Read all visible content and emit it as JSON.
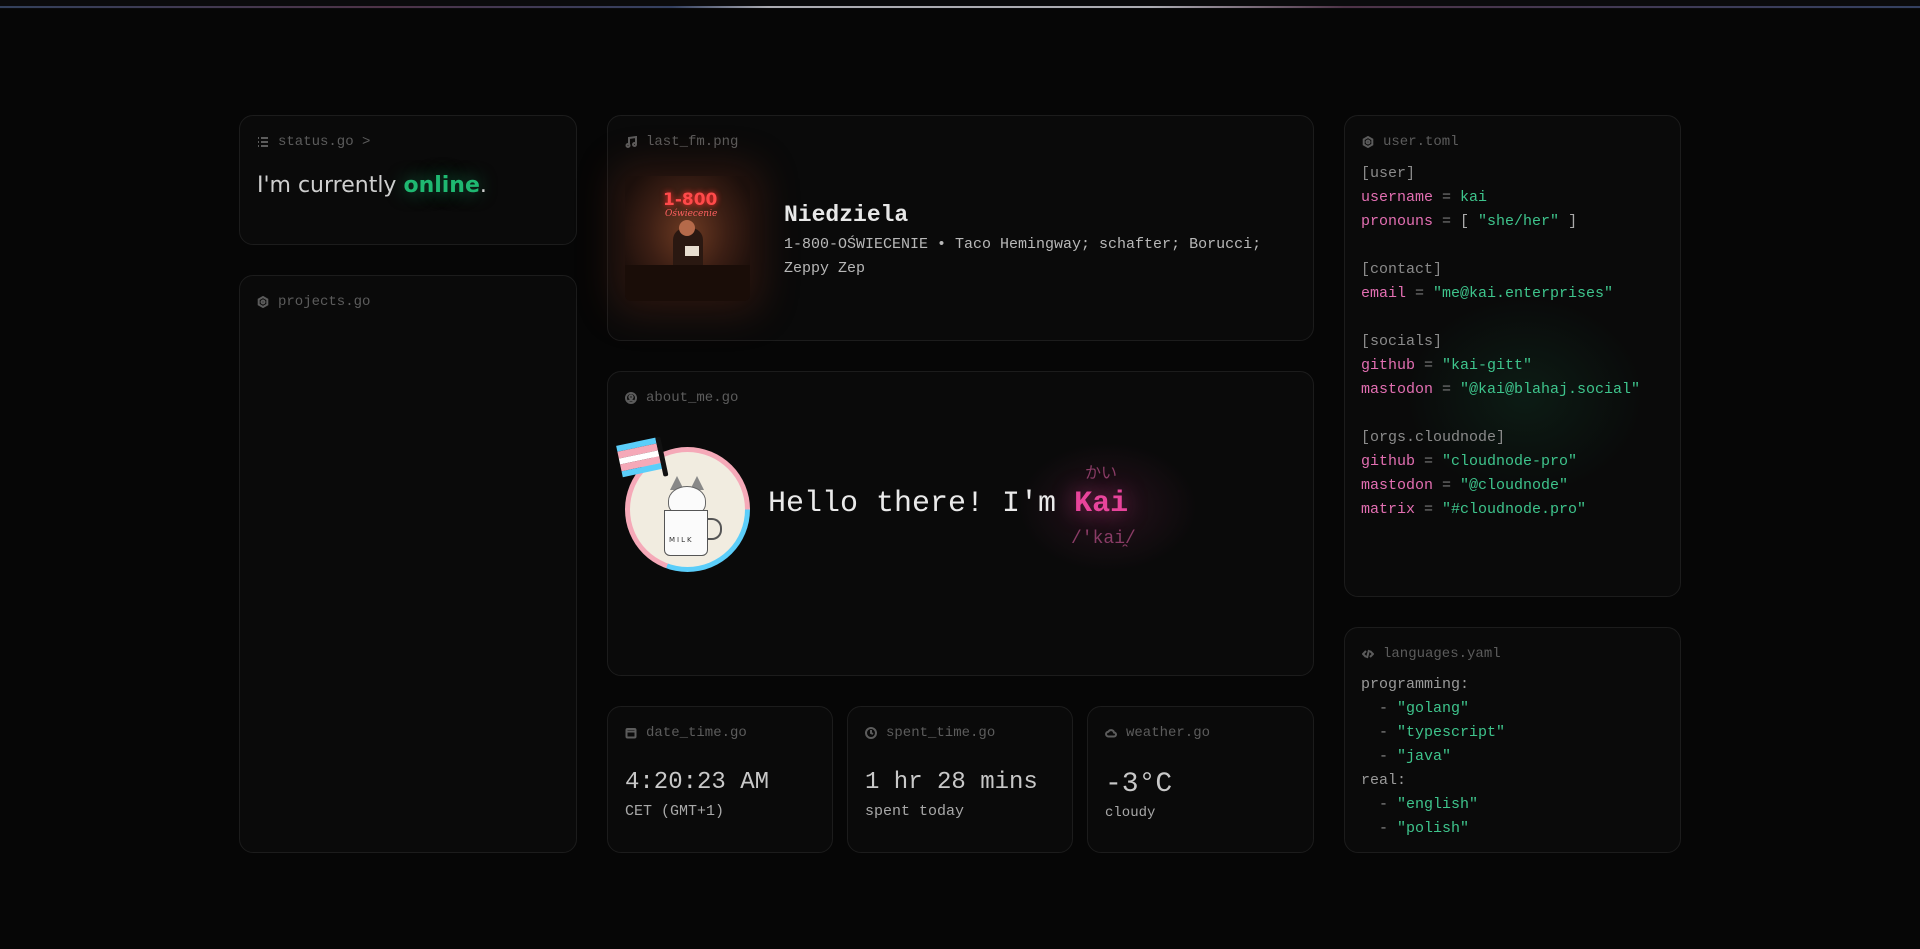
{
  "status": {
    "title": "status.go >",
    "prefix": "I'm currently ",
    "state": "online",
    "suffix": "."
  },
  "projects": {
    "title": "projects.go"
  },
  "lastfm": {
    "title": "last_fm.png",
    "track": "Niedziela",
    "album_artists": "1-800-OŚWIECENIE • Taco Hemingway; schafter; Borucci; Zeppy Zep",
    "album_art_text": "1-800",
    "album_art_subtext": "Oświecenie"
  },
  "about": {
    "title": "about_me.go",
    "greeting": "Hello there! I'm ",
    "name": "Kai",
    "kana": "かい",
    "ipa": "/'kai̯/",
    "mug_text": "MILK"
  },
  "datetime": {
    "title": "date_time.go",
    "time": "4:20:23 AM",
    "zone": "CET (GMT+1)"
  },
  "spent": {
    "title": "spent_time.go",
    "value": "1 hr 28 mins",
    "label": "spent today"
  },
  "weather": {
    "title": "weather.go",
    "temp": "-3°C",
    "condition": "cloudy"
  },
  "usertoml": {
    "title": "user.toml",
    "sections": [
      {
        "header": "[user]",
        "entries": [
          {
            "key": "username",
            "value": "kai",
            "type": "ident"
          },
          {
            "key": "pronouns",
            "value": "\"she/her\"",
            "type": "array"
          }
        ]
      },
      {
        "header": "[contact]",
        "entries": [
          {
            "key": "email",
            "value": "\"me@kai.enterprises\"",
            "type": "string"
          }
        ]
      },
      {
        "header": "[socials]",
        "entries": [
          {
            "key": "github",
            "value": "\"kai-gitt\"",
            "type": "string"
          },
          {
            "key": "mastodon",
            "value": "\"@kai@blahaj.social\"",
            "type": "string"
          }
        ]
      },
      {
        "header": "[orgs.cloudnode]",
        "entries": [
          {
            "key": "github",
            "value": "\"cloudnode-pro\"",
            "type": "string"
          },
          {
            "key": "mastodon",
            "value": "\"@cloudnode\"",
            "type": "string"
          },
          {
            "key": "matrix",
            "value": "\"#cloudnode.pro\"",
            "type": "string"
          }
        ]
      }
    ]
  },
  "languages": {
    "title": "languages.yaml",
    "programming_key": "programming:",
    "programming": [
      "\"golang\"",
      "\"typescript\"",
      "\"java\""
    ],
    "real_key": "real:",
    "real": [
      "\"english\"",
      "\"polish\""
    ]
  },
  "colors": {
    "accent_green": "#1fb871",
    "accent_pink": "#e8449b",
    "toml_key": "#e36fb2",
    "toml_string": "#3ec48c",
    "background": "#060606"
  },
  "icons": {
    "status": "list-icon",
    "projects": "hexagon-icon",
    "lastfm": "music-note-icon",
    "about": "user-circle-icon",
    "datetime": "calendar-icon",
    "spent": "clock-icon",
    "weather": "cloud-icon",
    "usertoml": "gear-icon",
    "languages": "code-icon"
  }
}
